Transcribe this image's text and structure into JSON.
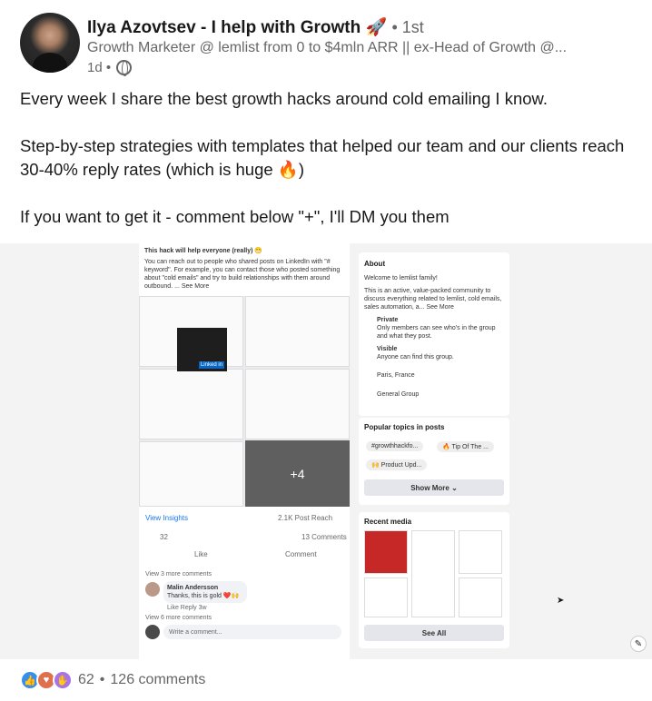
{
  "post": {
    "author_name": "Ilya Azovtsev - I help with Growth",
    "author_emoji": "🚀",
    "connection": "• 1st",
    "headline": "Growth Marketer @ lemlist from 0 to $4mln ARR || ex-Head of Growth @...",
    "time": "1d •",
    "text": [
      "Every week I share the best growth hacks around cold emailing I know.",
      "Step-by-step strategies with templates that helped our team and our clients reach 30-40% reply rates (which is huge 🔥)",
      "If you want to get it - comment below \"+\", I'll DM you them"
    ]
  },
  "embed": {
    "intro": "This hack will help everyone (really) 😁",
    "body": "You can reach out to people who shared posts on LinkedIn with \"# keyword\". For example, you can contact those who posted something about \"cold emails\" and try to build relationships with them around outbound. ... See More",
    "plus_more": "+4",
    "linkedin_label": "Linked in",
    "view_insights": "View Insights",
    "post_reach": "2.1K Post Reach",
    "reaction_count": "32",
    "comment_count": "13 Comments",
    "like": "Like",
    "comment": "Comment",
    "view_more_comments_1": "View 3 more comments",
    "commenter": "Malin Andersson",
    "comment_text": "Thanks, this is gold ❤️🙌",
    "comment_actions": "Like   Reply   3w",
    "view_more_comments_2": "View 6 more comments",
    "write_comment": "Write a comment...",
    "about_title": "About",
    "about_welcome": "Welcome to lemlist family!",
    "about_desc": "This is an active, value-packed community to discuss everything related to lemlist, cold emails, sales automation, a... See More",
    "private_title": "Private",
    "private_desc": "Only members can see who's in the group and what they post.",
    "visible_title": "Visible",
    "visible_desc": "Anyone can find this group.",
    "location": "Paris, France",
    "group_type": "General Group",
    "popular_title": "Popular topics in posts",
    "topics": [
      "#growthhackfo...",
      "🔥 Tip Of The ...",
      "🙌 Product Upd..."
    ],
    "show_more": "Show More ⌄",
    "recent_media_title": "Recent media",
    "see_all": "See All"
  },
  "footer": {
    "reaction_total": "62",
    "separator": "•",
    "comments": "126 comments"
  },
  "colors": {
    "like_blue": "#378fe9",
    "love_red": "#df704d",
    "support_purple": "#a872e8"
  }
}
